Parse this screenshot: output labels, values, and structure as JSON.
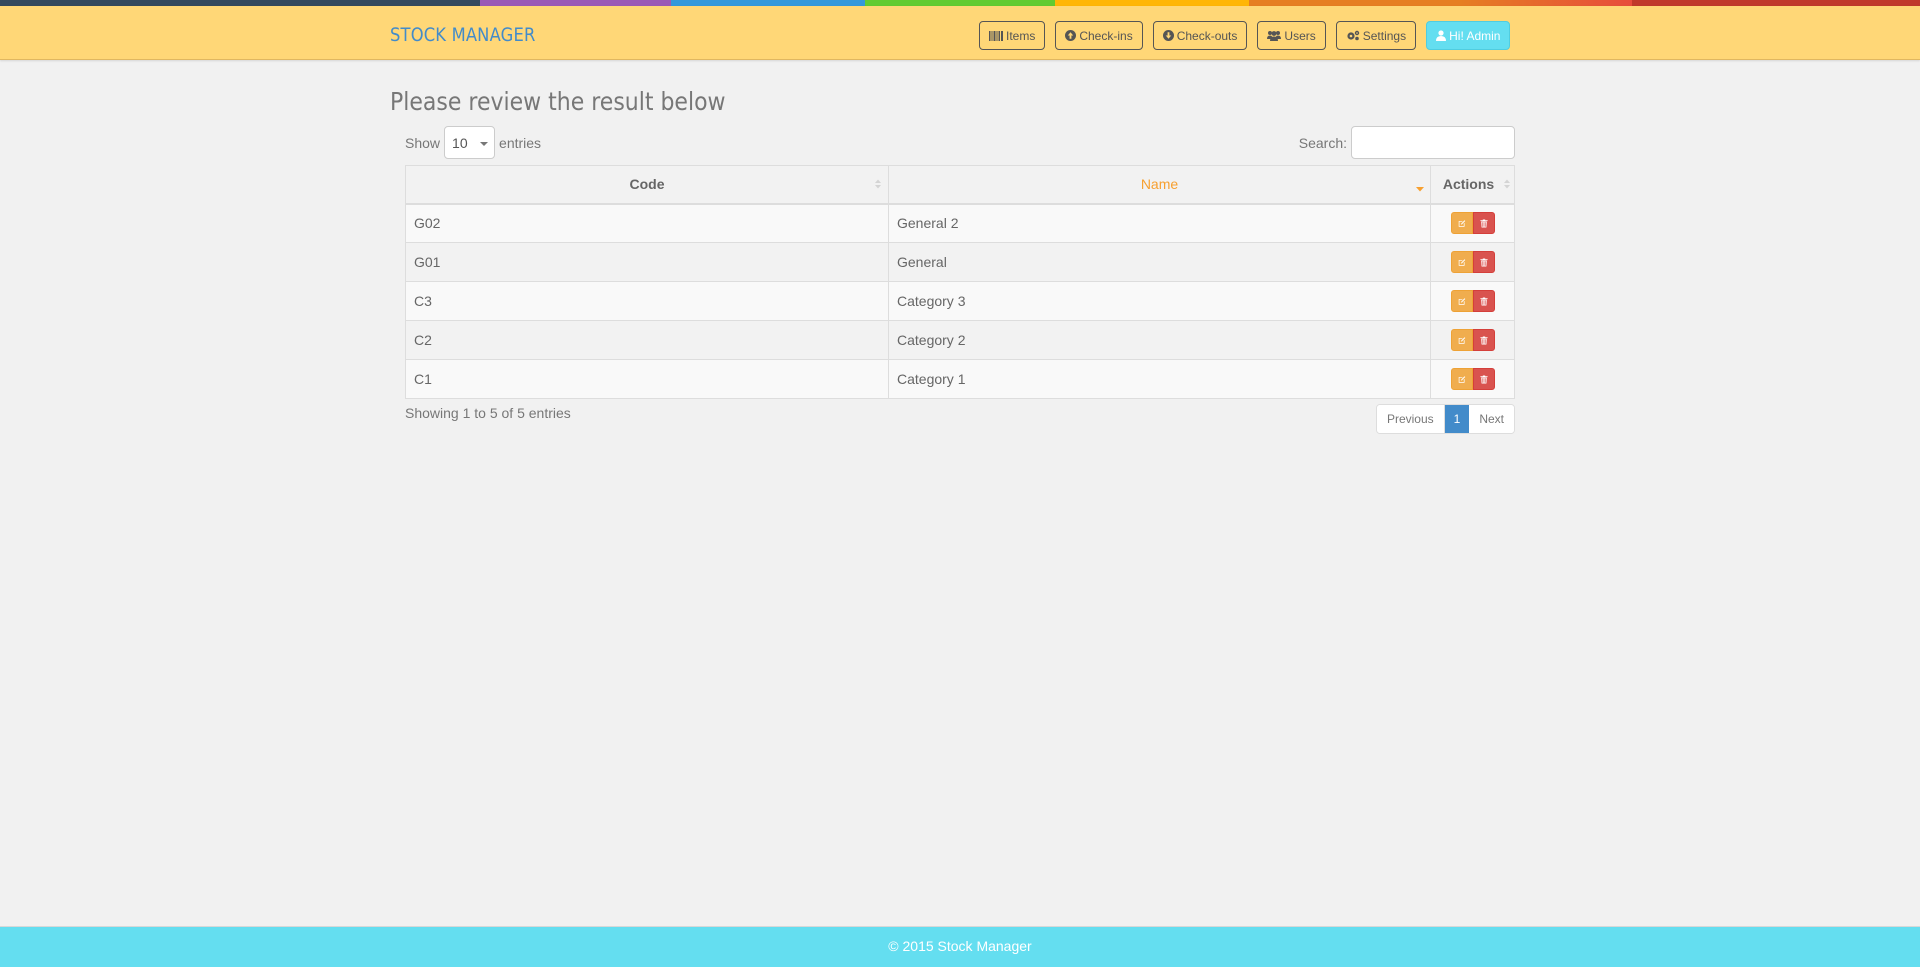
{
  "stripe_colors": [
    "#34495e",
    "#9b59b6",
    "#3498db",
    "#62cb31",
    "#ffb606",
    "#e67e22",
    "#e74c3c",
    "#c0392b"
  ],
  "header": {
    "brand": "STOCK MANAGER",
    "nav": [
      {
        "label": "Items",
        "icon": "barcode-icon"
      },
      {
        "label": "Check-ins",
        "icon": "arrow-circle-up-icon"
      },
      {
        "label": "Check-outs",
        "icon": "arrow-circle-down-icon"
      },
      {
        "label": "Users",
        "icon": "users-icon"
      },
      {
        "label": "Settings",
        "icon": "gears-icon"
      },
      {
        "label": "Hi! Admin",
        "icon": "user-icon"
      }
    ]
  },
  "main": {
    "title": "Please review the result below",
    "length_menu": {
      "prefix": "Show",
      "value": "10",
      "suffix": "entries"
    },
    "search": {
      "label": "Search:",
      "value": "",
      "placeholder": ""
    },
    "table": {
      "columns": [
        {
          "label": "Code",
          "sort": "none"
        },
        {
          "label": "Name",
          "sort": "desc"
        },
        {
          "label": "Actions",
          "sort": "none"
        }
      ],
      "rows": [
        {
          "code": "G02",
          "name": "General 2"
        },
        {
          "code": "G01",
          "name": "General"
        },
        {
          "code": "C3",
          "name": "Category 3"
        },
        {
          "code": "C2",
          "name": "Category 2"
        },
        {
          "code": "C1",
          "name": "Category 1"
        }
      ]
    },
    "info": "Showing 1 to 5 of 5 entries",
    "pagination": {
      "previous": "Previous",
      "current": "1",
      "next": "Next"
    }
  },
  "footer": {
    "text": "© 2015 Stock Manager"
  },
  "colors": {
    "navbar": "#ffd777",
    "brand": "#428bca",
    "admin_button": "#64def0",
    "sort_active": "#f7a030",
    "edit_button": "#f0ad4e",
    "delete_button": "#d9534f",
    "page_active": "#428bca",
    "footer": "#64def0"
  }
}
